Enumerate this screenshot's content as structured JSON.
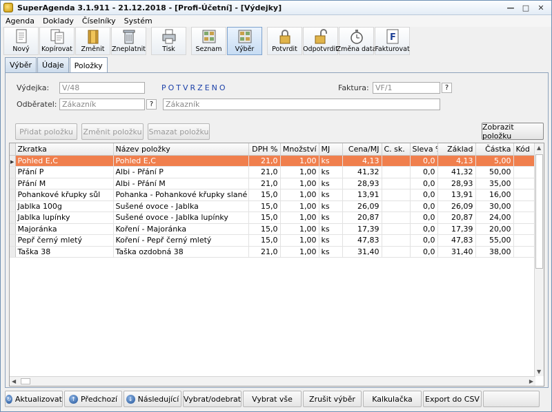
{
  "window": {
    "title": "SuperAgenda 3.1.911 - 21.12.2018 - [Profi-Účetní] - [Výdejky]",
    "controls": [
      "minimize-icon",
      "maximize-icon",
      "close-icon"
    ]
  },
  "menu": [
    "Agenda",
    "Doklady",
    "Číselníky",
    "Systém"
  ],
  "toolbar": {
    "groups": [
      [
        {
          "label": "Nový",
          "icon": "new-document-icon"
        },
        {
          "label": "Kopírovat",
          "icon": "copy-document-icon"
        },
        {
          "label": "Změnit",
          "icon": "edit-folder-icon"
        },
        {
          "label": "Zneplatnit",
          "icon": "trash-icon"
        }
      ],
      [
        {
          "label": "Tisk",
          "icon": "printer-icon"
        }
      ],
      [
        {
          "label": "Seznam",
          "icon": "list-view-icon"
        },
        {
          "label": "Výběr",
          "icon": "selection-view-icon",
          "active": true
        }
      ],
      [
        {
          "label": "Potvrdit",
          "icon": "lock-icon"
        },
        {
          "label": "Odpotvrdit",
          "icon": "unlock-icon"
        },
        {
          "label": "Změna data",
          "icon": "stopwatch-icon"
        },
        {
          "label": "Fakturovat",
          "icon": "invoice-icon"
        }
      ]
    ]
  },
  "tabs": [
    {
      "label": "Výběr"
    },
    {
      "label": "Údaje"
    },
    {
      "label": "Položky",
      "active": true
    }
  ],
  "form": {
    "vydejka_label": "Výdejka:",
    "vydejka_value": "V/48",
    "status": "POTVRZENO",
    "faktura_label": "Faktura:",
    "faktura_value": "VF/1",
    "odberatel_label": "Odběratel:",
    "odberatel_value": "Zákazník",
    "odberatel_name": "Zákazník",
    "lookup_label": "?"
  },
  "actions": {
    "add": "Přidat položku",
    "edit": "Změnit položku",
    "delete": "Smazat položku",
    "show": "Zobrazit položku"
  },
  "grid": {
    "columns": [
      "Zkratka",
      "Název položky",
      "DPH %",
      "Množství",
      "MJ",
      "Cena/MJ",
      "C. sk.",
      "Sleva %",
      "Základ",
      "Částka",
      "Kód"
    ],
    "rows": [
      [
        "Pohled E,C",
        "Pohled E,C",
        "21,0",
        "1,00",
        "ks",
        "4,13",
        "",
        "0,0",
        "4,13",
        "5,00",
        ""
      ],
      [
        "Přání P",
        "Albi - Přání P",
        "21,0",
        "1,00",
        "ks",
        "41,32",
        "",
        "0,0",
        "41,32",
        "50,00",
        ""
      ],
      [
        "Přání M",
        "Albi - Přání M",
        "21,0",
        "1,00",
        "ks",
        "28,93",
        "",
        "0,0",
        "28,93",
        "35,00",
        ""
      ],
      [
        "Pohankové křupky sůl",
        "Pohanka - Pohankové křupky slané",
        "15,0",
        "1,00",
        "ks",
        "13,91",
        "",
        "0,0",
        "13,91",
        "16,00",
        ""
      ],
      [
        "Jablka 100g",
        "Sušené ovoce - Jablka",
        "15,0",
        "1,00",
        "ks",
        "26,09",
        "",
        "0,0",
        "26,09",
        "30,00",
        ""
      ],
      [
        "Jablka lupínky",
        "Sušené ovoce - Jablka lupínky",
        "15,0",
        "1,00",
        "ks",
        "20,87",
        "",
        "0,0",
        "20,87",
        "24,00",
        ""
      ],
      [
        "Majoránka",
        "Koření - Majoránka",
        "15,0",
        "1,00",
        "ks",
        "17,39",
        "",
        "0,0",
        "17,39",
        "20,00",
        ""
      ],
      [
        "Pepř černý mletý",
        "Koření - Pepř černý mletý",
        "15,0",
        "1,00",
        "ks",
        "47,83",
        "",
        "0,0",
        "47,83",
        "55,00",
        ""
      ],
      [
        "Taška 38",
        "Taška ozdobná  38",
        "21,0",
        "1,00",
        "ks",
        "31,40",
        "",
        "0,0",
        "31,40",
        "38,00",
        ""
      ]
    ],
    "selected_row": 0,
    "selection_color": "#f07f4d"
  },
  "bottom_bar": [
    {
      "label": "Aktualizovat",
      "icon": "refresh-icon"
    },
    {
      "label": "Předchozí",
      "icon": "arrow-up-icon"
    },
    {
      "label": "Následující",
      "icon": "arrow-down-icon"
    },
    {
      "label": "Vybrat/odebrat"
    },
    {
      "label": "Vybrat vše"
    },
    {
      "label": "Zrušit výběr"
    },
    {
      "label": "Kalkulačka"
    },
    {
      "label": "Export do CSV"
    },
    {
      "label": ""
    }
  ]
}
